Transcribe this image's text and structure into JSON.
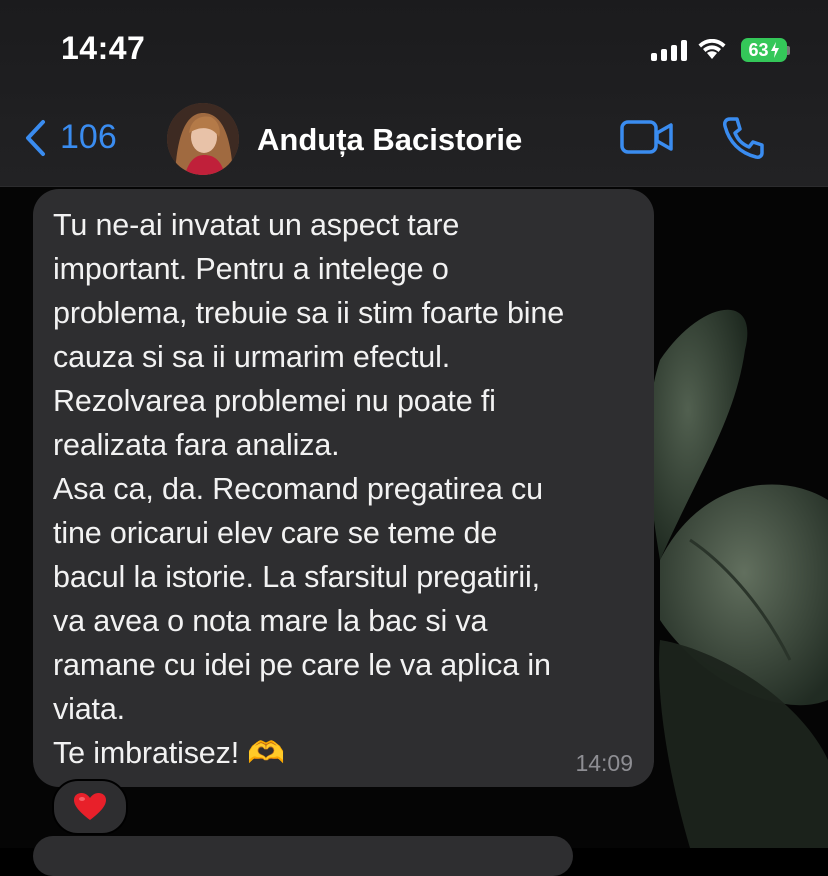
{
  "status_bar": {
    "time": "14:47",
    "battery_level": "63",
    "icons": [
      "signal-icon",
      "wifi-icon",
      "battery-charging-icon"
    ]
  },
  "header": {
    "back_count": "106",
    "back_icon": "chevron-left-icon",
    "contact_name": "Anduța Bacistorie",
    "actions": [
      "video-call-icon",
      "phone-icon"
    ],
    "accent_color": "#3a8cf0"
  },
  "message": {
    "lines": [
      "Tu ne-ai invatat un aspect tare",
      "important. Pentru a intelege o",
      "problema, trebuie sa ii stim foarte bine",
      "cauza si sa ii urmarim efectul.",
      "Rezolvarea problemei nu poate fi",
      "realizata fara analiza.",
      "Asa ca, da. Recomand pregatirea cu",
      "tine oricarui elev care se teme de",
      "bacul la istorie. La sfarsitul pregatirii,",
      "va avea o nota mare la bac si va",
      "ramane cu idei pe care le va aplica in",
      "viata.",
      "Te imbratisez! 🫶"
    ],
    "time": "14:09",
    "reaction": "❤️"
  }
}
